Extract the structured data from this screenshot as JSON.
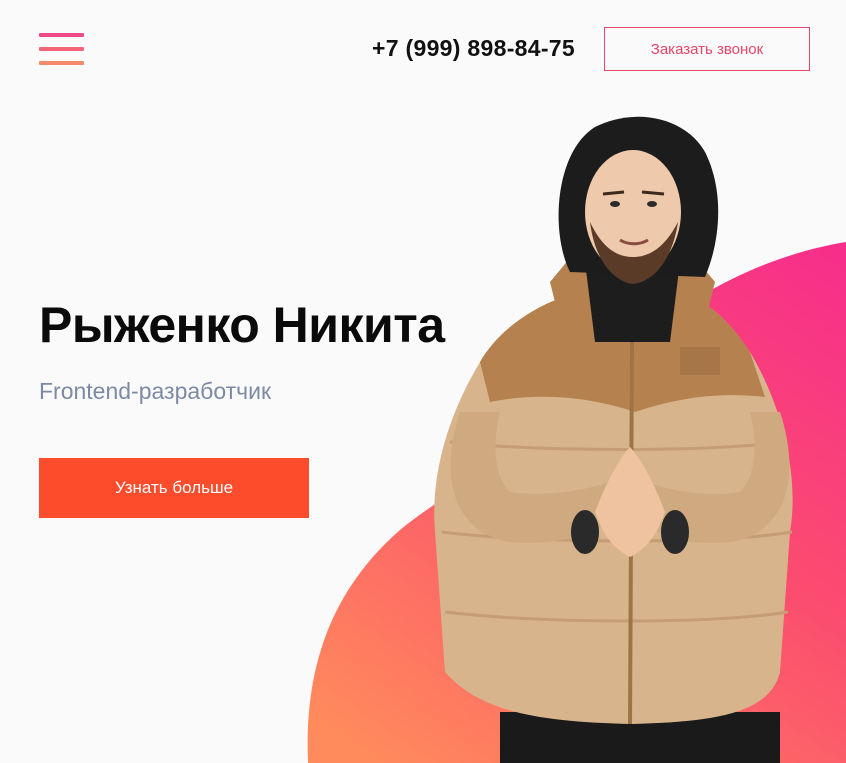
{
  "header": {
    "menu_icon": "hamburger-menu-icon",
    "phone": "+7 (999) 898-84-75",
    "call_button_label": "Заказать звонок"
  },
  "hero": {
    "title": "Рыженко Никита",
    "subtitle": "Frontend-разработчик",
    "cta_label": "Узнать больше",
    "photo": "person-photo"
  },
  "colors": {
    "background": "#fafafa",
    "menu_bar_1": "#ee4a8a",
    "menu_bar_2": "#f5667a",
    "menu_bar_3": "#f7896b",
    "call_button_border": "#e8456a",
    "cta_background": "#fd4c2b",
    "subtitle": "#7d8aa3",
    "blob_gradient_start": "#f7306f",
    "blob_gradient_end": "#ff8a5c",
    "jacket": "#d9b48c",
    "jacket_yoke": "#b88553"
  }
}
